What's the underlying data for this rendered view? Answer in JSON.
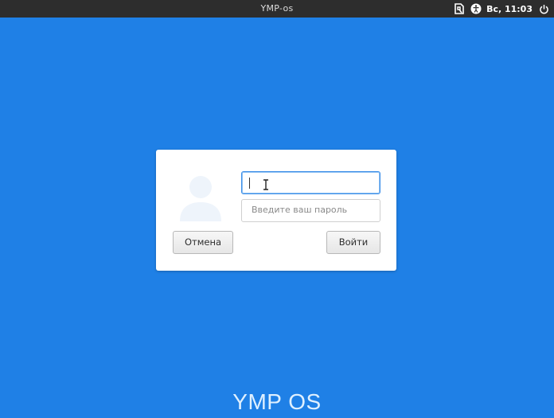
{
  "topbar": {
    "title": "YMP-os",
    "clock": "Вс, 11:03",
    "icons": [
      "keyboard-layout-icon",
      "accessibility-icon",
      "power-icon"
    ]
  },
  "login": {
    "username_value": "",
    "password_placeholder": "Введите ваш пароль",
    "cancel_label": "Отмена",
    "login_label": "Войти"
  },
  "brand": {
    "text": "YMP OS"
  },
  "colors": {
    "desktop_bg": "#1f80e6",
    "panel": "#2d2d2d",
    "focus": "#3b8ee8"
  }
}
